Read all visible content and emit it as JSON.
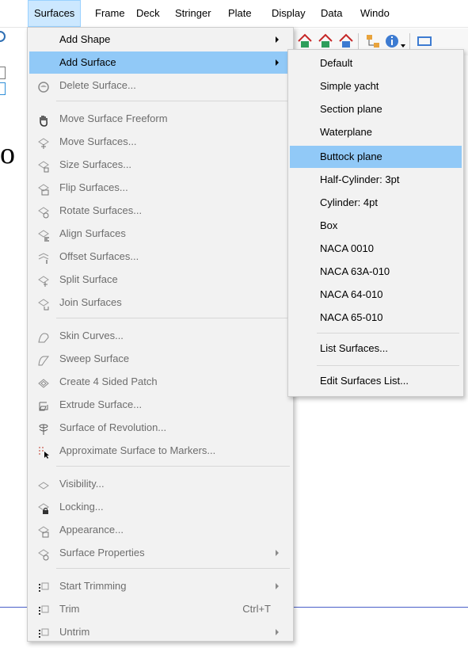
{
  "menubar": {
    "items": [
      {
        "label": "Surfaces",
        "active": true
      },
      {
        "label": "Frame"
      },
      {
        "label": "Deck"
      },
      {
        "label": "Stringer"
      },
      {
        "label": "Plate"
      },
      {
        "label": "Display"
      },
      {
        "label": "Data"
      },
      {
        "label": "Windo"
      }
    ]
  },
  "background": {
    "fragment_text": "o"
  },
  "menu": {
    "items": [
      {
        "label": "Add Shape",
        "submenu": true,
        "enabled": true,
        "icon": "none"
      },
      {
        "label": "Add Surface",
        "submenu": true,
        "enabled": true,
        "highlighted": true,
        "icon": "none"
      },
      {
        "label": "Delete Surface...",
        "enabled": false,
        "icon": "delete-surface-icon"
      },
      {
        "label": "Move Surface Freeform",
        "enabled": false,
        "icon": "hand-icon"
      },
      {
        "label": "Move Surfaces...",
        "enabled": false,
        "icon": "move-surfaces-icon"
      },
      {
        "label": "Size Surfaces...",
        "enabled": false,
        "icon": "size-surfaces-icon"
      },
      {
        "label": "Flip Surfaces...",
        "enabled": false,
        "icon": "flip-surfaces-icon"
      },
      {
        "label": "Rotate Surfaces...",
        "enabled": false,
        "icon": "rotate-surfaces-icon"
      },
      {
        "label": "Align Surfaces",
        "enabled": false,
        "icon": "align-surfaces-icon"
      },
      {
        "label": "Offset Surfaces...",
        "enabled": false,
        "icon": "offset-surfaces-icon"
      },
      {
        "label": "Split Surface",
        "enabled": false,
        "icon": "split-surface-icon"
      },
      {
        "label": "Join Surfaces",
        "enabled": false,
        "icon": "join-surfaces-icon"
      },
      {
        "label": "Skin Curves...",
        "enabled": false,
        "icon": "skin-curves-icon"
      },
      {
        "label": "Sweep Surface",
        "enabled": false,
        "icon": "sweep-surface-icon"
      },
      {
        "label": "Create 4 Sided Patch",
        "enabled": false,
        "icon": "four-sided-patch-icon"
      },
      {
        "label": "Extrude Surface...",
        "enabled": false,
        "icon": "extrude-surface-icon"
      },
      {
        "label": "Surface of Revolution...",
        "enabled": false,
        "icon": "surface-revolution-icon"
      },
      {
        "label": "Approximate Surface to Markers...",
        "enabled": false,
        "icon": "approximate-markers-icon"
      },
      {
        "label": "Visibility...",
        "enabled": false,
        "icon": "visibility-icon"
      },
      {
        "label": "Locking...",
        "enabled": false,
        "icon": "lock-icon"
      },
      {
        "label": "Appearance...",
        "enabled": false,
        "icon": "appearance-icon"
      },
      {
        "label": "Surface Properties",
        "enabled": false,
        "submenu": true,
        "icon": "surface-properties-icon"
      },
      {
        "label": "Start Trimming",
        "enabled": false,
        "submenu": true,
        "icon": "start-trimming-icon"
      },
      {
        "label": "Trim",
        "enabled": false,
        "shortcut": "Ctrl+T",
        "icon": "trim-icon"
      },
      {
        "label": "Untrim",
        "enabled": false,
        "submenu": true,
        "icon": "untrim-icon"
      }
    ]
  },
  "submenu": {
    "items": [
      {
        "label": "Default"
      },
      {
        "label": "Simple yacht"
      },
      {
        "label": "Section plane"
      },
      {
        "label": "Waterplane"
      },
      {
        "label": "Buttock plane",
        "highlighted": true
      },
      {
        "label": "Half-Cylinder: 3pt"
      },
      {
        "label": "Cylinder: 4pt"
      },
      {
        "label": "Box"
      },
      {
        "label": "NACA 0010"
      },
      {
        "label": "NACA 63A-010"
      },
      {
        "label": "NACA 64-010"
      },
      {
        "label": "NACA 65-010"
      },
      {
        "label": "List Surfaces..."
      },
      {
        "label": "Edit Surfaces List..."
      }
    ]
  },
  "colors": {
    "highlight": "#91c9f7",
    "menubar_active": "#cce8ff",
    "disabled_text": "#6d6d6d",
    "accent_line": "#4a5fc8"
  }
}
